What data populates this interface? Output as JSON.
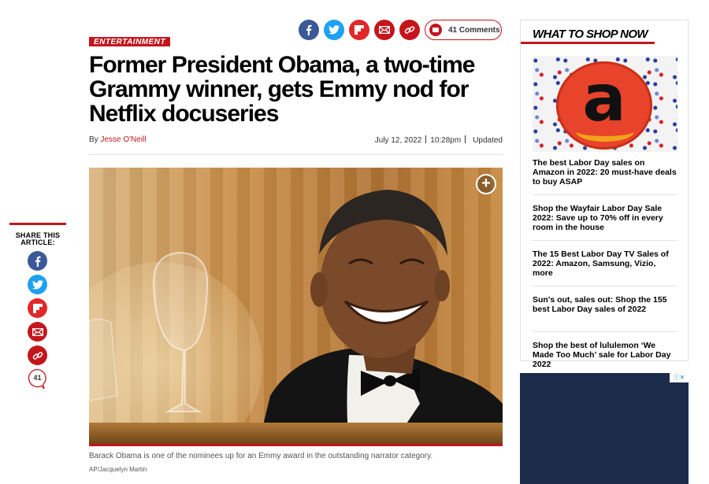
{
  "share_rail": {
    "label": "SHARE THIS ARTICLE:",
    "comment_count": "41",
    "icons": [
      "facebook-icon",
      "twitter-icon",
      "flipboard-icon",
      "email-icon",
      "link-icon",
      "comment-icon"
    ]
  },
  "article": {
    "category": "ENTERTAINMENT",
    "comments_label": "41 Comments",
    "headline": "Former President Obama, a two-time Grammy winner, gets Emmy nod for Netflix docuseries",
    "byline_prefix": "By",
    "author": "Jesse O'Neill",
    "date": "July 12, 2022",
    "time": "10:28pm",
    "updated_label": "Updated",
    "caption": "Barack Obama is one of the nominees up for an Emmy award in the outstanding narrator category.",
    "credit": "AP/Jacquelyn Martin"
  },
  "sidebar": {
    "title": "WHAT TO SHOP NOW",
    "items": [
      "The best Labor Day sales on Amazon in 2022: 20 must-have deals to buy ASAP",
      "Shop the Wayfair Labor Day Sale 2022: Save up to 70% off in every room in the house",
      "The 15 Best Labor Day TV Sales of 2022: Amazon, Samsung, Vizio, more",
      "Sun's out, sales out: Shop the 155 best Labor Day sales of 2022",
      "Shop the best of lululemon ‘We Made Too Much’ sale for Labor Day 2022"
    ]
  },
  "colors": {
    "brand_red": "#c4151c",
    "facebook": "#3b5998",
    "twitter": "#1da1f2",
    "flipboard": "#e12828"
  }
}
